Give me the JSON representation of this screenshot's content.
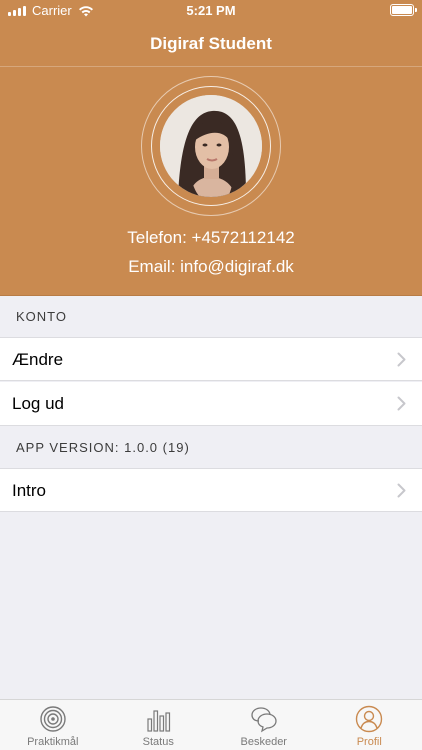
{
  "status_bar": {
    "carrier": "Carrier",
    "time": "5:21 PM"
  },
  "header": {
    "title": "Digiraf Student",
    "phone": "Telefon: +4572112142",
    "email": "Email: info@digiraf.dk"
  },
  "sections": {
    "account_header": "KONTO",
    "edit_label": "Ændre",
    "logout_label": "Log ud",
    "version_header": "APP VERSION: 1.0.0 (19)",
    "intro_label": "Intro"
  },
  "tabs": [
    {
      "label": "Praktikmål",
      "icon": "target-icon"
    },
    {
      "label": "Status",
      "icon": "bar-chart-icon"
    },
    {
      "label": "Beskeder",
      "icon": "chat-bubbles-icon"
    },
    {
      "label": "Profil",
      "icon": "profile-icon",
      "active": true
    }
  ],
  "colors": {
    "accent": "#c98a50",
    "background": "#efeff4"
  }
}
